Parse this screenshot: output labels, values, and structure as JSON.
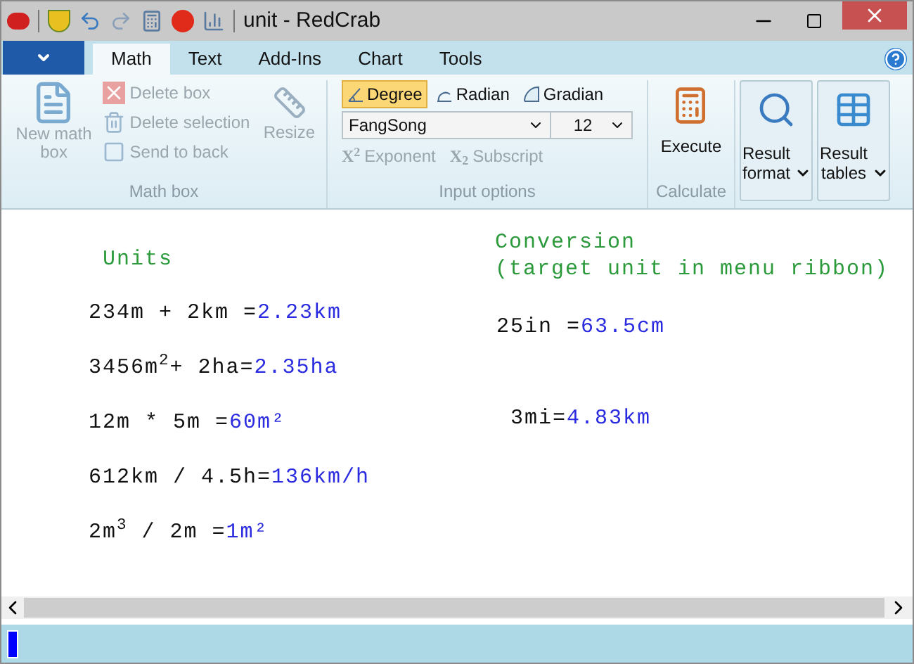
{
  "window": {
    "title": "unit - RedCrab"
  },
  "tabs": [
    {
      "label": "Math",
      "selected": true
    },
    {
      "label": "Text",
      "selected": false
    },
    {
      "label": "Add-Ins",
      "selected": false
    },
    {
      "label": "Chart",
      "selected": false
    },
    {
      "label": "Tools",
      "selected": false
    }
  ],
  "math_box_group": {
    "title": "Math box",
    "new_math_box": {
      "label": "New math box",
      "disabled": true
    },
    "actions": [
      {
        "label": "Delete box",
        "disabled": true,
        "kind": "delete"
      },
      {
        "label": "Delete selection",
        "disabled": true,
        "kind": "selection"
      },
      {
        "label": "Send to back",
        "disabled": true,
        "kind": "back"
      }
    ],
    "resize": {
      "label": "Resize",
      "disabled": true
    }
  },
  "input_options_group": {
    "title": "Input options",
    "angle_modes": [
      {
        "label": "Degree",
        "selected": true,
        "kind": "degree"
      },
      {
        "label": "Radian",
        "selected": false,
        "kind": "radian"
      },
      {
        "label": "Gradian",
        "selected": false,
        "kind": "gradian"
      }
    ],
    "font": "FangSong",
    "size": "12",
    "format_buttons": [
      {
        "label": "Exponent",
        "symbol": "X$^{2}$",
        "disabled": true
      },
      {
        "label": "Subscript",
        "symbol": "X$_{2}$",
        "disabled": true
      }
    ]
  },
  "calculate_group": {
    "title": "Calculate",
    "execute": "Execute"
  },
  "result_buttons": [
    {
      "label": "Result format",
      "kind": "format"
    },
    {
      "label": "Result tables",
      "kind": "tables"
    }
  ],
  "worksheet": {
    "left": {
      "heading": "Units",
      "expressions": [
        {
          "input": "234m + 2km =",
          "result": "2.23km"
        },
        {
          "input": "3456m$^{2}$+ 2ha=",
          "result": "2.35ha"
        },
        {
          "input": "12m * 5m =",
          "result": "60m²"
        },
        {
          "input": "612km / 4.5h=",
          "result": "136km/h"
        },
        {
          "input": "2m$^{3}$ / 2m =",
          "result": "1m²"
        }
      ]
    },
    "right": {
      "heading": [
        "Conversion",
        "(target unit in menu ribbon)"
      ],
      "expressions": [
        {
          "input": "25in =",
          "result": "63.5cm"
        },
        {
          "input": "3mi=",
          "result": "4.83km"
        }
      ]
    }
  }
}
